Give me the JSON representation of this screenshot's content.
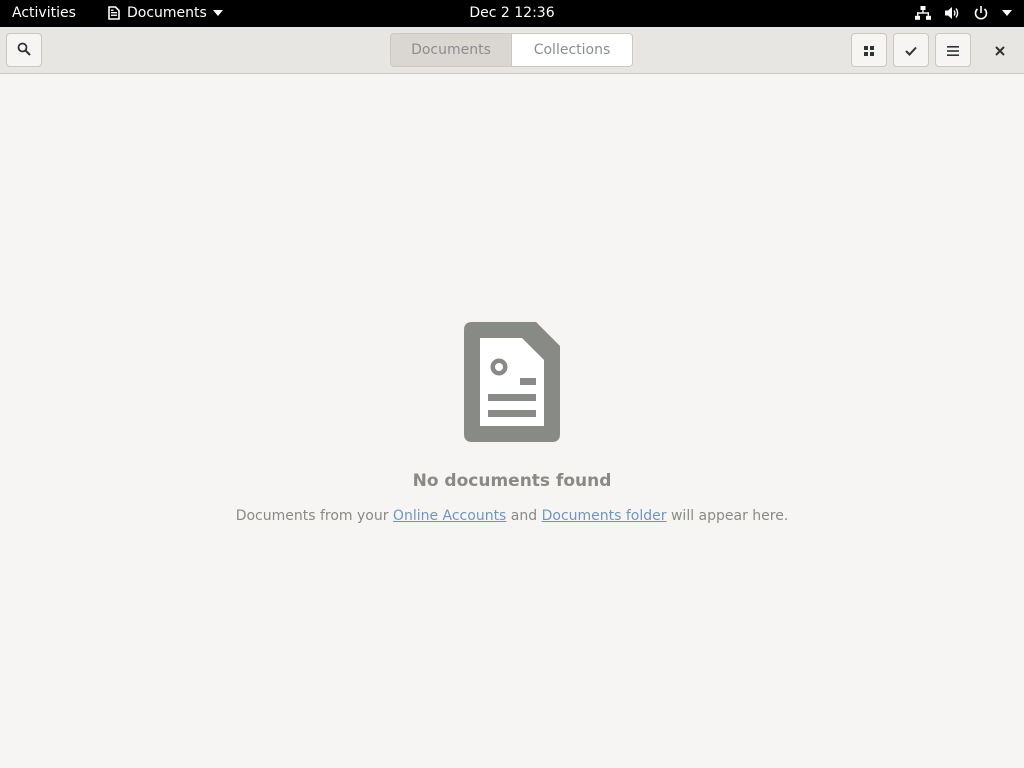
{
  "topbar": {
    "activities": "Activities",
    "app_menu_label": "Documents",
    "clock": "Dec 2  12:36",
    "tray_icons": [
      "network-icon",
      "volume-icon",
      "power-icon",
      "chevron-down-icon"
    ]
  },
  "headerbar": {
    "switcher": {
      "documents": "Documents",
      "collections": "Collections",
      "active": "Documents"
    },
    "buttons": [
      "search-icon",
      "grid-view-icon",
      "selection-check-icon",
      "hamburger-menu-icon",
      "close-icon"
    ]
  },
  "empty_state": {
    "title": "No documents found",
    "desc_prefix": "Documents from your ",
    "link_online_accounts": "Online Accounts",
    "desc_and": " and ",
    "link_documents_folder": "Documents folder",
    "desc_suffix": " will appear here."
  },
  "colors": {
    "topbar_bg": "#000000",
    "headerbar_bg": "#e8e6e3",
    "content_bg": "#f6f5f4",
    "icon_gray": "#888a85",
    "link_blue": "#6c97c4"
  }
}
